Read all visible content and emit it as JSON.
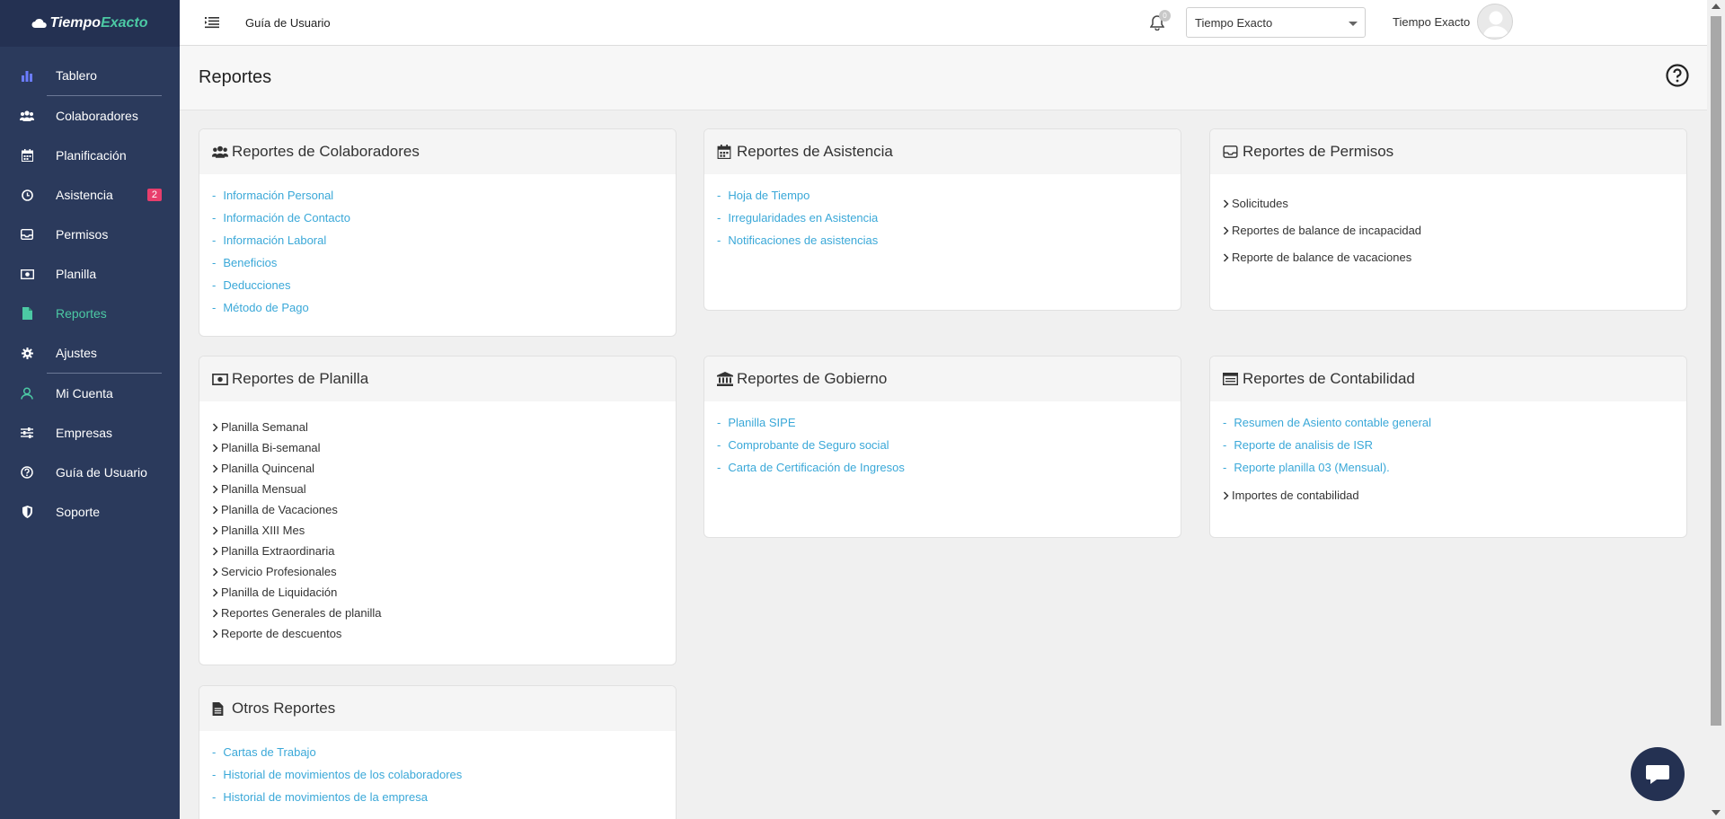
{
  "brand": {
    "part1": "Tiempo",
    "part2": "Exacto"
  },
  "colors": {
    "sidebar_bg": "#2b3a5c",
    "accent": "#4cc9a4",
    "link": "#3aa8d8",
    "badge": "#e83e6c"
  },
  "sidebar": {
    "items": [
      {
        "label": "Tablero",
        "icon": "bar-chart-icon"
      },
      {
        "label": "Colaboradores",
        "icon": "users-icon"
      },
      {
        "label": "Planificación",
        "icon": "calendar-icon"
      },
      {
        "label": "Asistencia",
        "icon": "clock-icon",
        "badge": "2"
      },
      {
        "label": "Permisos",
        "icon": "inbox-icon"
      },
      {
        "label": "Planilla",
        "icon": "money-icon"
      },
      {
        "label": "Reportes",
        "icon": "file-icon",
        "active": true
      },
      {
        "label": "Ajustes",
        "icon": "gear-icon"
      },
      {
        "label": "Mi Cuenta",
        "icon": "user-icon"
      },
      {
        "label": "Empresas",
        "icon": "sliders-icon"
      },
      {
        "label": "Guía de Usuario",
        "icon": "help-icon"
      },
      {
        "label": "Soporte",
        "icon": "shield-icon"
      }
    ]
  },
  "topbar": {
    "guide_label": "Guía de Usuario",
    "notification_count": "0",
    "company_selected": "Tiempo Exacto",
    "user_name": "Tiempo Exacto"
  },
  "page": {
    "title": "Reportes"
  },
  "cards": {
    "colaboradores": {
      "title": "Reportes de Colaboradores",
      "items": [
        "Información Personal",
        "Información de Contacto",
        "Información Laboral",
        "Beneficios",
        "Deducciones",
        "Método de Pago"
      ]
    },
    "asistencia": {
      "title": "Reportes de Asistencia",
      "items": [
        "Hoja de Tiempo",
        "Irregularidades en Asistencia",
        "Notificaciones de asistencias"
      ]
    },
    "permisos": {
      "title": "Reportes de Permisos",
      "items": [
        "Solicitudes",
        "Reportes de balance de incapacidad",
        "Reporte de balance de vacaciones"
      ]
    },
    "planilla": {
      "title": "Reportes de Planilla",
      "items": [
        "Planilla Semanal",
        "Planilla Bi-semanal",
        "Planilla Quincenal",
        "Planilla Mensual",
        "Planilla de Vacaciones",
        "Planilla XIII Mes",
        "Planilla Extraordinaria",
        "Servicio Profesionales",
        "Planilla de Liquidación",
        "Reportes Generales de planilla",
        "Reporte de descuentos"
      ]
    },
    "gobierno": {
      "title": "Reportes de Gobierno",
      "items": [
        "Planilla SIPE",
        "Comprobante de Seguro social",
        "Carta de Certificación de Ingresos"
      ]
    },
    "contabilidad": {
      "title": "Reportes de Contabilidad",
      "links": [
        "Resumen de Asiento contable general",
        "Reporte de analisis de ISR",
        "Reporte planilla 03 (Mensual)."
      ],
      "sub_item": "Importes de contabilidad"
    },
    "otros": {
      "title": "Otros Reportes",
      "items": [
        "Cartas de Trabajo",
        "Historial de movimientos de los colaboradores",
        "Historial de movimientos de la empresa"
      ]
    }
  }
}
